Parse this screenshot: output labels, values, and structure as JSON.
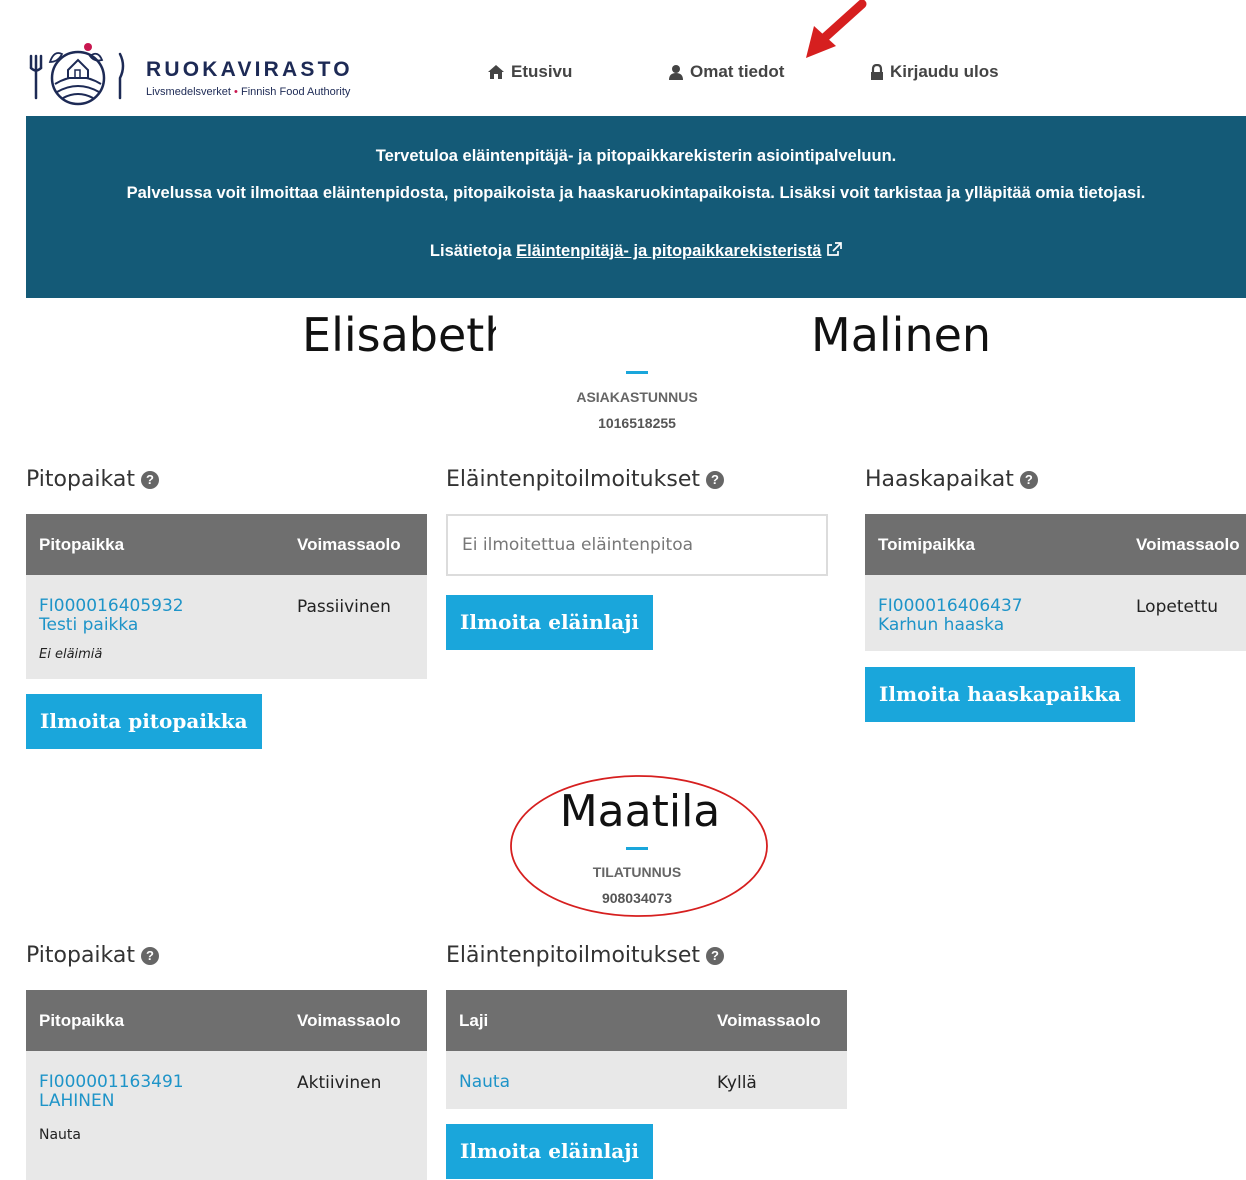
{
  "brand": {
    "name": "RUOKAVIRASTO",
    "sub_left": "Livsmedelsverket",
    "sub_dot": "•",
    "sub_right": "Finnish Food Authority"
  },
  "nav": {
    "home": "Etusivu",
    "profile": "Omat tiedot",
    "logout": "Kirjaudu ulos"
  },
  "banner": {
    "title": "Tervetuloa eläintenpitäjä- ja pitopaikkarekisterin asiointipalveluun.",
    "description": "Palvelussa voit ilmoittaa eläintenpidosta, pitopaikoista ja haaskaruokintapaikoista. Lisäksi voit tarkistaa ja ylläpitää omia tietojasi.",
    "more_prefix": "Lisätietoja",
    "more_link": "Eläintenpitäjä- ja pitopaikkarekisteristä"
  },
  "person": {
    "first_name": "Elisabeth",
    "last_name": "Malinen",
    "customer_label": "ASIAKASTUNNUS",
    "customer_id": "1016518255"
  },
  "person_sections": {
    "pitopaikat": {
      "title": "Pitopaikat",
      "columns": [
        "Pitopaikka",
        "Voimassaolo"
      ],
      "rows": [
        {
          "id": "FI000016405932",
          "name": "Testi paikka",
          "note": "Ei eläimiä",
          "status": "Passiivinen"
        }
      ],
      "button": "Ilmoita pitopaikka"
    },
    "ilmoitukset": {
      "title": "Eläintenpitoilmoitukset",
      "empty_text": "Ei ilmoitettua eläintenpitoa",
      "button": "Ilmoita eläinlaji"
    },
    "haaskapaikat": {
      "title": "Haaskapaikat",
      "columns": [
        "Toimipaikka",
        "Voimassaolo"
      ],
      "rows": [
        {
          "id": "FI000016406437",
          "name": "Karhun haaska",
          "status": "Lopetettu"
        }
      ],
      "button": "Ilmoita haaskapaikka"
    }
  },
  "farm": {
    "title": "Maatila",
    "label": "TILATUNNUS",
    "id": "908034073"
  },
  "farm_sections": {
    "pitopaikat": {
      "title": "Pitopaikat",
      "columns": [
        "Pitopaikka",
        "Voimassaolo"
      ],
      "rows": [
        {
          "id": "FI000001163491",
          "name": "LAHINEN",
          "note": "Nauta",
          "status": "Aktiivinen"
        }
      ]
    },
    "ilmoitukset": {
      "title": "Eläintenpitoilmoitukset",
      "columns": [
        "Laji",
        "Voimassaolo"
      ],
      "rows": [
        {
          "species": "Nauta",
          "status": "Kyllä"
        }
      ],
      "button": "Ilmoita eläinlaji"
    }
  },
  "colors": {
    "banner": "#145a77",
    "accent": "#1aa6db",
    "table_header": "#6f6f6f",
    "annotation_red": "#d61f1f"
  }
}
